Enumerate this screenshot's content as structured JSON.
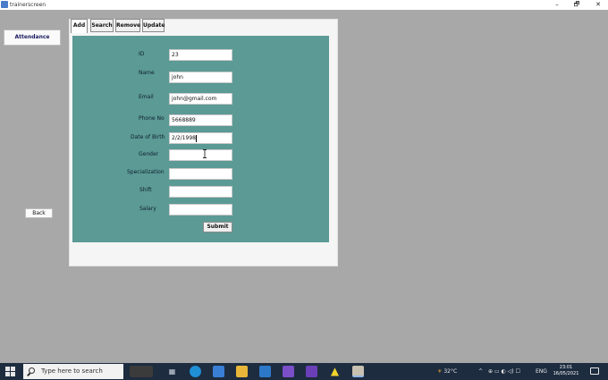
{
  "window": {
    "title": "trainerscreen",
    "minimize_label": "–",
    "maximize_label": "🗗",
    "close_label": "✕"
  },
  "sidebar": {
    "attendance_label": "Attendance",
    "back_label": "Back"
  },
  "tabs": [
    {
      "label": "Add",
      "selected": true
    },
    {
      "label": "Search"
    },
    {
      "label": "Remove"
    },
    {
      "label": "Update"
    }
  ],
  "form": {
    "fields": [
      {
        "label": "ID",
        "value": "23"
      },
      {
        "label": "Name",
        "value": "john"
      },
      {
        "label": "Email",
        "value": "john@gmail.com"
      },
      {
        "label": "Phone No",
        "value": "5668889"
      },
      {
        "label": "Date of Birth",
        "value": "2/2/1998"
      },
      {
        "label": "Gender",
        "value": ""
      },
      {
        "label": "Specialization",
        "value": ""
      },
      {
        "label": "Shift",
        "value": ""
      },
      {
        "label": "Salary",
        "value": ""
      }
    ],
    "submit_label": "Submit"
  },
  "colors": {
    "form_background": "#5b9a95",
    "taskbar": "#1d2c3f",
    "desktop": "#a8a8a8"
  },
  "taskbar": {
    "search_placeholder": "Type here to search",
    "weather": "32°C",
    "language": "ENG",
    "time": "23:01",
    "date": "16/05/2021"
  }
}
